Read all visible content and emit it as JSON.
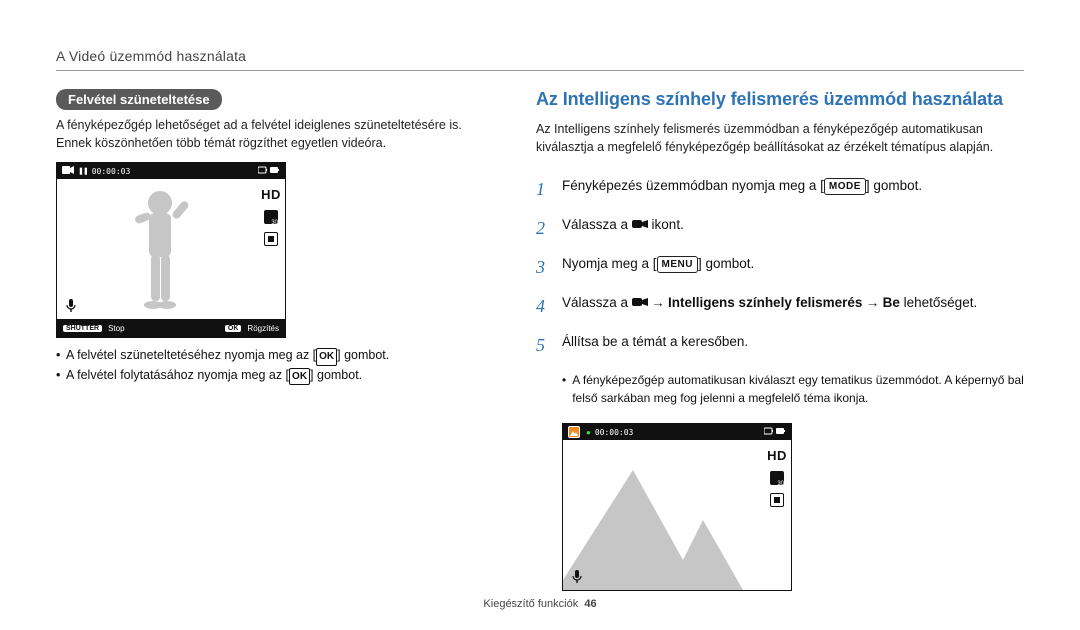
{
  "breadcrumb": "A Videó üzemmód használata",
  "left": {
    "pill": "Felvétel szüneteltetése",
    "intro": "A fényképezőgép lehetőséget ad a felvétel ideiglenes szüneteltetésére is. Ennek köszönhetően több témát rögzíthet egyetlen videóra.",
    "screen": {
      "rec_dot": "●",
      "pause_icon": "❚❚",
      "time": "00:00:03",
      "hd": "HD",
      "fps_badge": "30",
      "shutter_key": "SHUTTER",
      "stop": "Stop",
      "ok_key": "OK",
      "rec_label": "Rögzítés"
    },
    "bullets": {
      "b1_pre": "A felvétel szüneteltetéséhez nyomja meg az [",
      "b1_post": "] gombot.",
      "b2_pre": "A felvétel folytatásához nyomja meg az [",
      "b2_post": "] gombot.",
      "ok_inline": "OK"
    }
  },
  "right": {
    "title": "Az Intelligens színhely felismerés üzemmód használata",
    "intro": "Az Intelligens színhely felismerés üzemmódban a fényképezőgép automatikusan kiválasztja a megfelelő fényképezőgép beállításokat az érzékelt tématípus alapján.",
    "steps": {
      "n1": "1",
      "s1_pre": "Fényképezés üzemmódban nyomja meg a [",
      "s1_key": "MODE",
      "s1_post": "] gombot.",
      "n2": "2",
      "s2_pre": "Válassza a ",
      "s2_post": " ikont.",
      "n3": "3",
      "s3_pre": "Nyomja meg a [",
      "s3_key": "MENU",
      "s3_post": "] gombot.",
      "n4": "4",
      "s4_pre": "Válassza a ",
      "s4_arrow1": " → ",
      "s4_bold": "Intelligens színhely felismerés",
      "s4_arrow2": " → ",
      "s4_be": "Be",
      "s4_post": " lehetőséget.",
      "n5": "5",
      "s5": "Állítsa be a témát a keresőben."
    },
    "note": "A fényképezőgép automatikusan kiválaszt egy tematikus üzemmódot. A képernyő bal felső sarkában meg fog jelenni a megfelelő téma ikonja.",
    "screen": {
      "rec_dot": "●",
      "time": "00:00:03",
      "hd": "HD",
      "fps_badge": "30"
    }
  },
  "footer": {
    "label": "Kiegészítő funkciók",
    "page": "46"
  }
}
